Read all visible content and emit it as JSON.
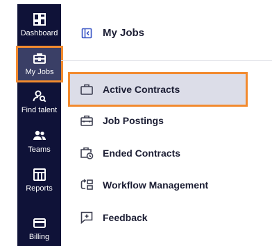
{
  "rail": {
    "items": [
      {
        "label": "Dashboard",
        "icon": "dashboard-icon",
        "active": false
      },
      {
        "label": "My Jobs",
        "icon": "briefcase-icon",
        "active": true
      },
      {
        "label": "Find talent",
        "icon": "find-talent-icon",
        "active": false
      },
      {
        "label": "Teams",
        "icon": "teams-icon",
        "active": false
      },
      {
        "label": "Reports",
        "icon": "reports-icon",
        "active": false
      },
      {
        "label": "Billing",
        "icon": "billing-icon",
        "active": false
      }
    ]
  },
  "panel": {
    "title": "My Jobs",
    "collapse_icon": "sidebar-collapse-icon",
    "items": [
      {
        "label": "Active Contracts",
        "icon": "briefcase-outline-icon",
        "active": true
      },
      {
        "label": "Job Postings",
        "icon": "toolbox-icon",
        "active": false
      },
      {
        "label": "Ended Contracts",
        "icon": "briefcase-clock-icon",
        "active": false
      },
      {
        "label": "Workflow Management",
        "icon": "workflow-icon",
        "active": false
      },
      {
        "label": "Feedback",
        "icon": "feedback-icon",
        "active": false
      }
    ]
  },
  "colors": {
    "rail_bg": "#0f1238",
    "highlight_outline": "#f28a2e",
    "active_item_bg": "#dcdde8",
    "text_dark": "#1b1d33"
  }
}
